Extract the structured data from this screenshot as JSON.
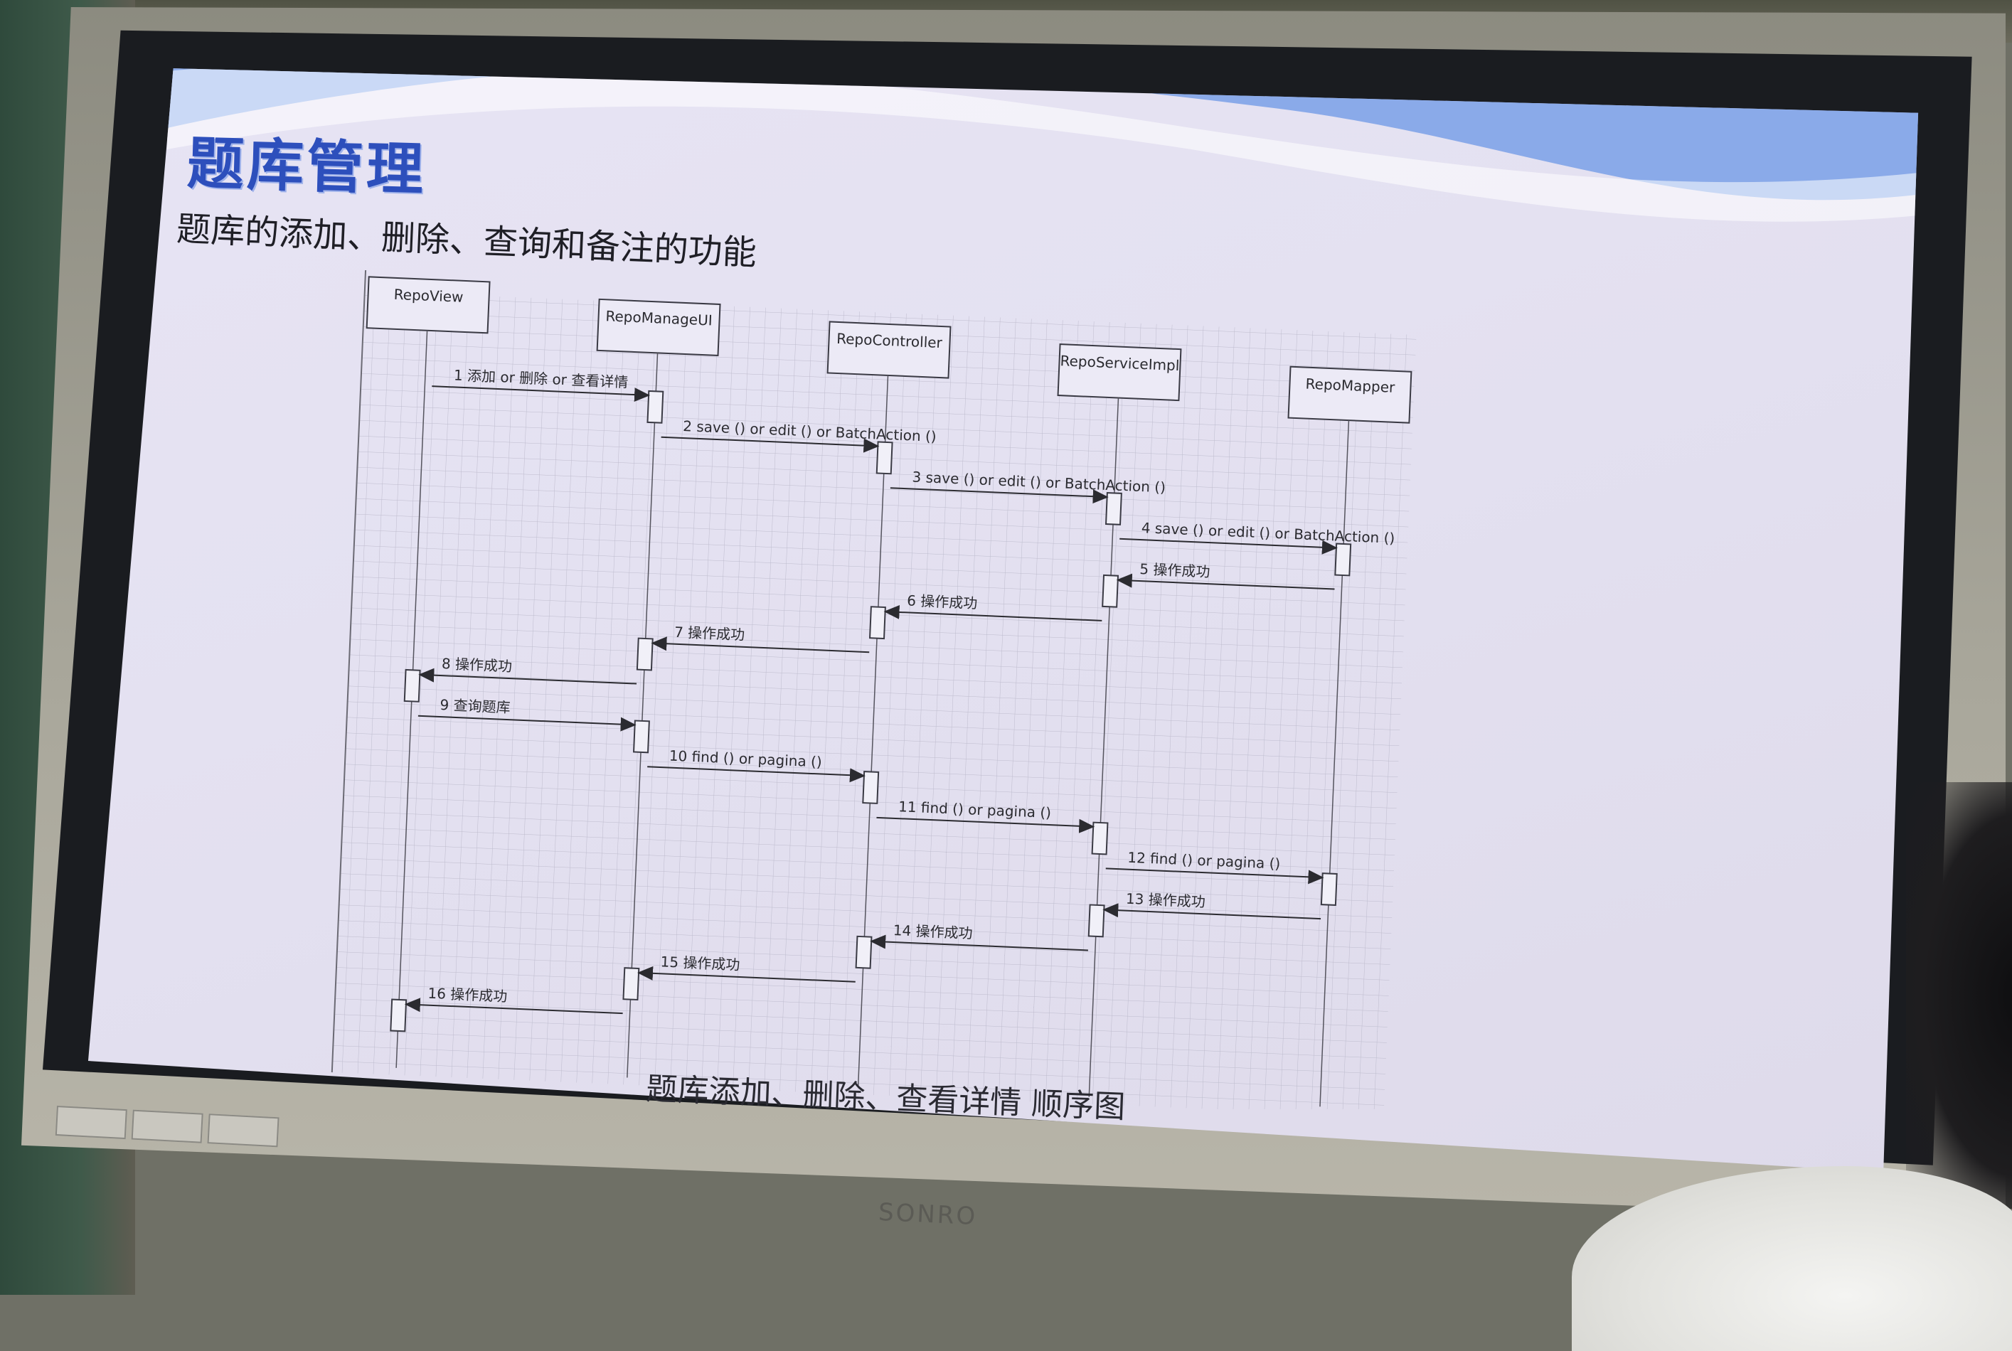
{
  "slide": {
    "title": "题库管理",
    "subtitle": "题库的添加、删除、查询和备注的功能",
    "caption": "题库添加、删除、查看详情 顺序图"
  },
  "monitor": {
    "brand": "SONRO"
  },
  "colors": {
    "title": "#2d4fbc",
    "wave": "#6e97e3",
    "screen": "#e5e2f2"
  },
  "sequence_diagram": {
    "participants": [
      "RepoView",
      "RepoManageUI",
      "RepoController",
      "RepoServiceImpl",
      "RepoMapper"
    ],
    "messages": [
      {
        "from": "RepoView",
        "to": "RepoManageUI",
        "label": "1 添加 or 删除 or 查看详情"
      },
      {
        "from": "RepoManageUI",
        "to": "RepoController",
        "label": "2 save () or edit () or BatchAction ()"
      },
      {
        "from": "RepoController",
        "to": "RepoServiceImpl",
        "label": "3 save () or edit () or BatchAction ()"
      },
      {
        "from": "RepoServiceImpl",
        "to": "RepoMapper",
        "label": "4 save () or edit () or BatchAction ()"
      },
      {
        "from": "RepoMapper",
        "to": "RepoServiceImpl",
        "label": "5 操作成功"
      },
      {
        "from": "RepoServiceImpl",
        "to": "RepoController",
        "label": "6 操作成功"
      },
      {
        "from": "RepoController",
        "to": "RepoManageUI",
        "label": "7 操作成功"
      },
      {
        "from": "RepoManageUI",
        "to": "RepoView",
        "label": "8 操作成功"
      },
      {
        "from": "RepoView",
        "to": "RepoManageUI",
        "label": "9 查询题库"
      },
      {
        "from": "RepoManageUI",
        "to": "RepoController",
        "label": "10 find () or pagina ()"
      },
      {
        "from": "RepoController",
        "to": "RepoServiceImpl",
        "label": "11 find () or pagina ()"
      },
      {
        "from": "RepoServiceImpl",
        "to": "RepoMapper",
        "label": "12 find () or pagina ()"
      },
      {
        "from": "RepoMapper",
        "to": "RepoServiceImpl",
        "label": "13 操作成功"
      },
      {
        "from": "RepoServiceImpl",
        "to": "RepoController",
        "label": "14 操作成功"
      },
      {
        "from": "RepoController",
        "to": "RepoManageUI",
        "label": "15 操作成功"
      },
      {
        "from": "RepoManageUI",
        "to": "RepoView",
        "label": "16 操作成功"
      }
    ]
  }
}
